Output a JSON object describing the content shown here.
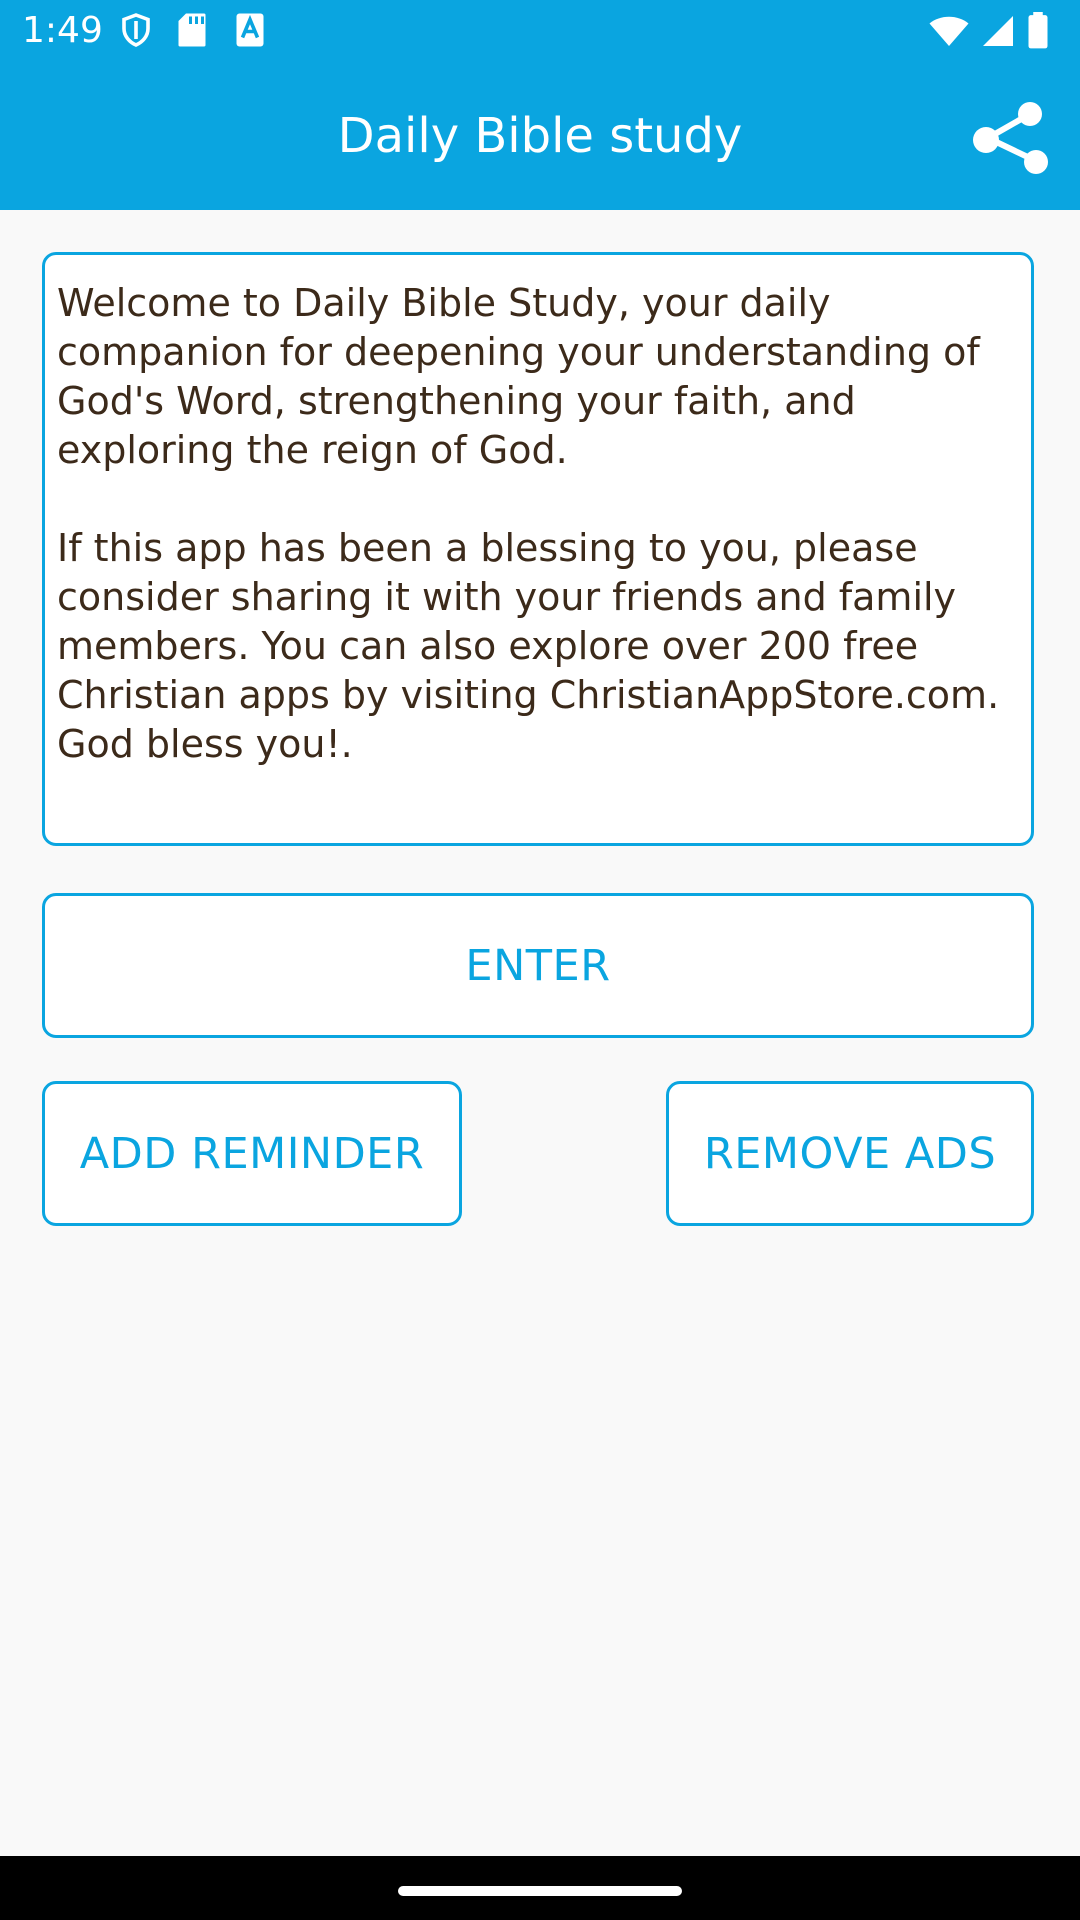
{
  "status_bar": {
    "time": "1:49",
    "left_icons": [
      "shield-icon",
      "sd-card-icon",
      "font-a-icon"
    ],
    "right_icons": [
      "wifi-icon",
      "signal-icon",
      "battery-icon"
    ]
  },
  "app_bar": {
    "title": "Daily Bible study",
    "share_icon": "share-icon"
  },
  "message": {
    "text": "Welcome to Daily Bible Study, your daily companion for deepening your understanding of God's Word, strengthening your faith, and exploring the reign of God.\n\nIf this app has been a blessing to you, please consider sharing it with your friends and family members. You can also explore over 200 free Christian apps by visiting ChristianAppStore.com. God bless you!."
  },
  "buttons": {
    "enter": "ENTER",
    "add_reminder": "ADD REMINDER",
    "remove_ads": "REMOVE ADS"
  },
  "colors": {
    "primary": "#0aa5e0",
    "text": "#3c2a1a",
    "background": "#f9f9f9"
  }
}
